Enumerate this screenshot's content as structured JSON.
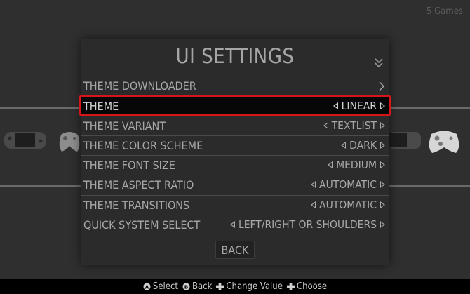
{
  "header": {
    "games_count": "5 Games"
  },
  "modal": {
    "title": "UI SETTINGS",
    "rows": [
      {
        "label": "THEME DOWNLOADER",
        "value": ""
      },
      {
        "label": "THEME",
        "value": "LINEAR"
      },
      {
        "label": "THEME VARIANT",
        "value": "TEXTLIST"
      },
      {
        "label": "THEME COLOR SCHEME",
        "value": "DARK"
      },
      {
        "label": "THEME FONT SIZE",
        "value": "MEDIUM"
      },
      {
        "label": "THEME ASPECT RATIO",
        "value": "AUTOMATIC"
      },
      {
        "label": "THEME TRANSITIONS",
        "value": "AUTOMATIC"
      },
      {
        "label": "QUICK SYSTEM SELECT",
        "value": "LEFT/RIGHT OR SHOULDERS"
      }
    ],
    "back_label": "BACK",
    "selected_row": "THEME"
  },
  "help": [
    {
      "icon": "a-button-icon",
      "label": "Select"
    },
    {
      "icon": "b-button-icon",
      "label": "Back"
    },
    {
      "icon": "dpad-icon",
      "label": "Change Value"
    },
    {
      "icon": "dpad-icon",
      "label": "Choose"
    }
  ],
  "colors": {
    "highlight_border": "#d6151b",
    "panel": "#2b2b2b",
    "text": "#a8a8a8"
  }
}
